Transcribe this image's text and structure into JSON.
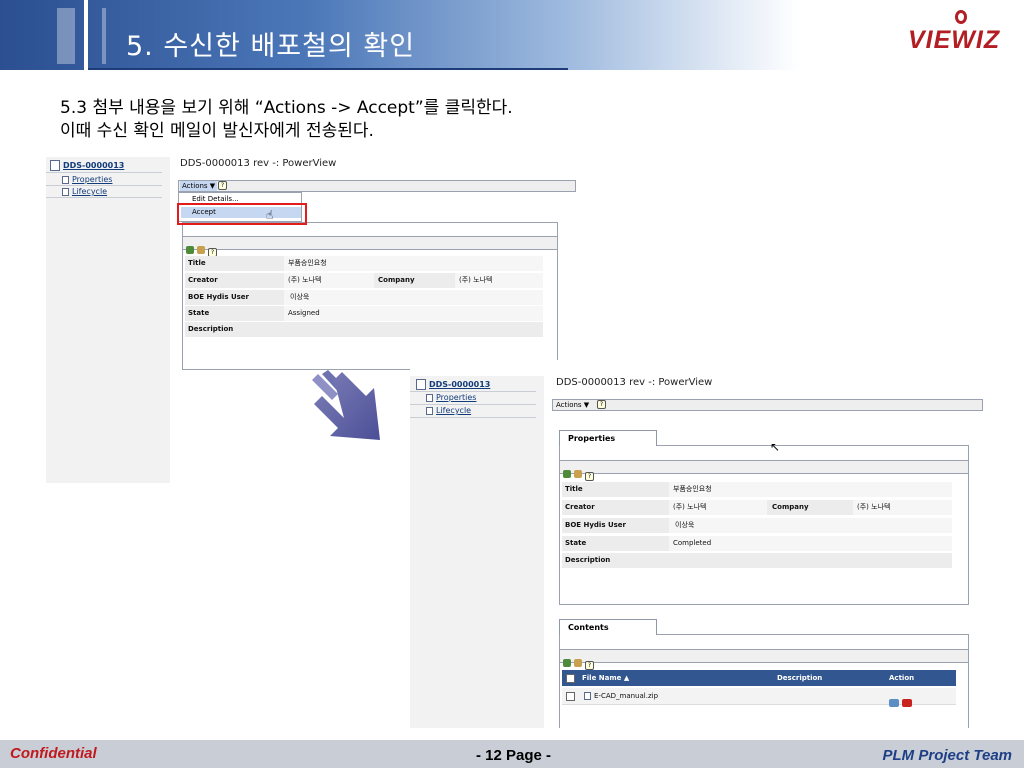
{
  "slide": {
    "title": "5. 수신한 배포철의 확인",
    "logo": "VIEWIZ",
    "instruction_line1": "5.3  첨부 내용을 보기 위해 “Actions -> Accept”를 클릭한다.",
    "instruction_line2": "이때 수신 확인 메일이 발신자에게 전송된다."
  },
  "screen1": {
    "tree": {
      "root": "DDS-0000013",
      "children": [
        "Properties",
        "Lifecycle"
      ]
    },
    "window_title": "DDS-0000013 rev -: PowerView",
    "actions_label": "Actions ▼",
    "menu": {
      "items": [
        "Edit Details...",
        "Accept"
      ],
      "highlighted": "Accept"
    },
    "properties": [
      {
        "label": "Title",
        "value": "부품승인요청"
      },
      {
        "label": "Creator",
        "value": "(주) 노나텍",
        "label2": "Company",
        "value2": "(주) 노나텍"
      },
      {
        "label": "BOE Hydis User",
        "value": "이상욱"
      },
      {
        "label": "State",
        "value": "Assigned"
      },
      {
        "label": "Description",
        "value": ""
      }
    ]
  },
  "screen2": {
    "tree": {
      "root": "DDS-0000013",
      "children": [
        "Properties",
        "Lifecycle"
      ]
    },
    "window_title": "DDS-0000013 rev -: PowerView",
    "actions_label": "Actions ▼",
    "properties_tab": "Properties",
    "properties": [
      {
        "label": "Title",
        "value": "부품승인요청"
      },
      {
        "label": "Creator",
        "value": "(주) 노나텍",
        "label2": "Company",
        "value2": "(주) 노나텍"
      },
      {
        "label": "BOE Hydis User",
        "value": "이상욱"
      },
      {
        "label": "State",
        "value": "Completed"
      },
      {
        "label": "Description",
        "value": ""
      }
    ],
    "contents_tab": "Contents",
    "contents_columns": [
      "File Name  ▲",
      "Description",
      "Action"
    ],
    "contents_rows": [
      {
        "file_name": "E-CAD_manual.zip",
        "description": ""
      }
    ]
  },
  "footer": {
    "left": "Confidential",
    "center": "- 12 Page -",
    "right": "PLM  Project Team"
  },
  "colors": {
    "accent_red": "#e31b1b",
    "header_blue": "#2b4f91",
    "table_header": "#32568f"
  }
}
